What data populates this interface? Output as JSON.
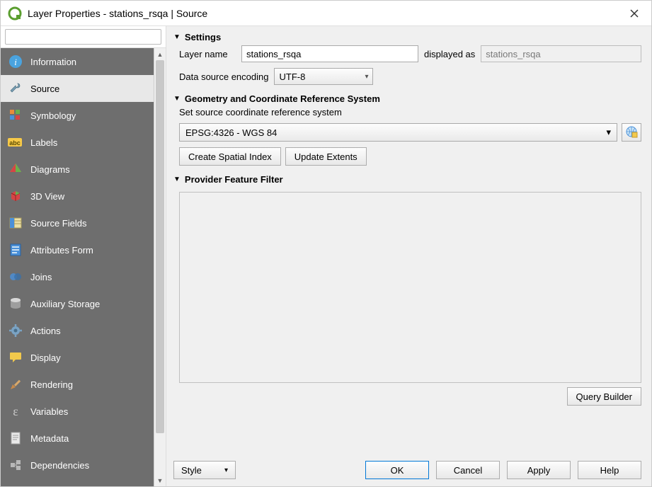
{
  "window": {
    "title": "Layer Properties - stations_rsqa | Source"
  },
  "search": {
    "placeholder": ""
  },
  "nav": {
    "items": [
      {
        "id": "information",
        "label": "Information"
      },
      {
        "id": "source",
        "label": "Source"
      },
      {
        "id": "symbology",
        "label": "Symbology"
      },
      {
        "id": "labels",
        "label": "Labels"
      },
      {
        "id": "diagrams",
        "label": "Diagrams"
      },
      {
        "id": "3dview",
        "label": "3D View"
      },
      {
        "id": "sourcefields",
        "label": "Source Fields"
      },
      {
        "id": "attributesform",
        "label": "Attributes Form"
      },
      {
        "id": "joins",
        "label": "Joins"
      },
      {
        "id": "auxstorage",
        "label": "Auxiliary Storage"
      },
      {
        "id": "actions",
        "label": "Actions"
      },
      {
        "id": "display",
        "label": "Display"
      },
      {
        "id": "rendering",
        "label": "Rendering"
      },
      {
        "id": "variables",
        "label": "Variables"
      },
      {
        "id": "metadata",
        "label": "Metadata"
      },
      {
        "id": "dependencies",
        "label": "Dependencies"
      }
    ],
    "selected": "source"
  },
  "sections": {
    "settings": {
      "title": "Settings",
      "layer_name_label": "Layer name",
      "layer_name_value": "stations_rsqa",
      "displayed_as_label": "displayed as",
      "displayed_as_value": "stations_rsqa",
      "encoding_label": "Data source encoding",
      "encoding_value": "UTF-8"
    },
    "geometry": {
      "title": "Geometry and Coordinate Reference System",
      "set_crs_label": "Set source coordinate reference system",
      "crs_value": "EPSG:4326 - WGS 84",
      "btn_create_index": "Create Spatial Index",
      "btn_update_extents": "Update Extents"
    },
    "filter": {
      "title": "Provider Feature Filter",
      "btn_query_builder": "Query Builder"
    }
  },
  "footer": {
    "style": "Style",
    "ok": "OK",
    "cancel": "Cancel",
    "apply": "Apply",
    "help": "Help"
  }
}
